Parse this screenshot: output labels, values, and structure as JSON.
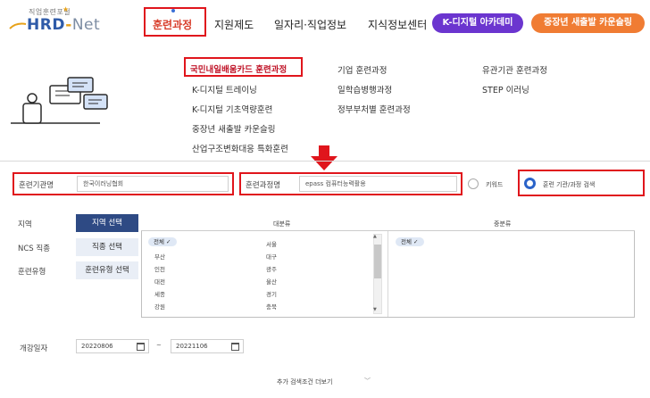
{
  "header": {
    "logo_small": "직업훈련포털",
    "logo_main": "HRD",
    "logo_dash": "-",
    "logo_net": "Net",
    "nav": {
      "training": "훈련과정",
      "support": "지원제도",
      "jobs": "일자리·직업정보",
      "knowledge": "지식정보센터"
    },
    "pill_k_digital": "K-디지털 아카데미",
    "pill_midcareer": "중장년 새출발 카운슬링",
    "pill_k_color": "#6b35cf",
    "pill_mid_color": "#f07c33"
  },
  "menu": {
    "col1": [
      "국민내일배움카드 훈련과정",
      "K-디지털 트레이닝",
      "K-디지털 기초역량훈련",
      "중장년 새출발 카운슬링",
      "산업구조변화대응 특화훈련"
    ],
    "col2": [
      "기업 훈련과정",
      "일학습병행과정",
      "정부부처별 훈련과정"
    ],
    "col3": [
      "유관기관 훈련과정",
      "STEP 이러닝"
    ]
  },
  "search": {
    "org_label": "훈련기관명",
    "org_value": "한국이러닝협회",
    "course_label": "훈련과정명",
    "course_value": "epass 컴퓨터능력활용",
    "keyword_label": "키워드",
    "orgsearch_label": "훈련 기관/과정 검색",
    "region_label": "지역",
    "region_button": "지역 선택",
    "ncs_label": "NCS 직종",
    "ncs_button": "직종 선택",
    "type_label": "훈련유형",
    "type_button": "훈련유형 선택",
    "major_header": "대분류",
    "minor_header": "중분류",
    "regions_left": [
      "전체",
      "부산",
      "인천",
      "대전",
      "세종",
      "강원"
    ],
    "regions_right": [
      "서울",
      "대구",
      "광주",
      "울산",
      "경기",
      "충북"
    ],
    "minor_selected": "전체",
    "period_label": "개강일자",
    "date_start": "20220806",
    "date_tilde": "~",
    "date_end": "20221106",
    "more_label": "추가 검색조건 더보기"
  },
  "colors": {
    "highlight_red": "#e0151c",
    "accent_blue": "#2a63c9",
    "region_button_bg": "#2e4a84"
  }
}
